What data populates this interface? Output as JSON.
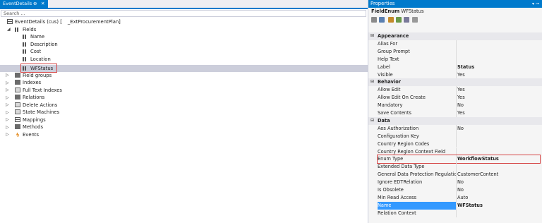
{
  "left_tab": {
    "title": "EventDetails",
    "pin": "⊕",
    "close": "✕"
  },
  "search": {
    "placeholder": "Search ..."
  },
  "tree": {
    "root": "EventDetails (cus) [",
    "root_model": "_ExtProcurementPlan]",
    "fields_label": "Fields",
    "fields": [
      "Name",
      "Description",
      "Cost",
      "Location",
      "WFStatus"
    ],
    "nodes": [
      "Field groups",
      "Indexes",
      "Full Text Indexes",
      "Relations",
      "Delete Actions",
      "State Machines",
      "Mappings",
      "Methods",
      "Events"
    ]
  },
  "properties": {
    "title": "Properties",
    "title_controls": "▾ ⊸",
    "object_type": "FieldEnum",
    "object_name": "WFStatus",
    "categories": [
      {
        "name": "Appearance",
        "rows": [
          {
            "k": "Alias For",
            "v": ""
          },
          {
            "k": "Group Prompt",
            "v": ""
          },
          {
            "k": "Help Text",
            "v": ""
          },
          {
            "k": "Label",
            "v": "Status"
          },
          {
            "k": "Visible",
            "v": "Yes"
          }
        ]
      },
      {
        "name": "Behavior",
        "rows": [
          {
            "k": "Allow Edit",
            "v": "Yes"
          },
          {
            "k": "Allow Edit On Create",
            "v": "Yes"
          },
          {
            "k": "Mandatory",
            "v": "No"
          },
          {
            "k": "Save Contents",
            "v": "Yes"
          }
        ]
      },
      {
        "name": "Data",
        "rows": [
          {
            "k": "Aos Authorization",
            "v": "No"
          },
          {
            "k": "Configuration Key",
            "v": ""
          },
          {
            "k": "Country Region Codes",
            "v": ""
          },
          {
            "k": "Country Region Context Field",
            "v": ""
          },
          {
            "k": "Enum Type",
            "v": "WorkflowStatus"
          },
          {
            "k": "Extended Data Type",
            "v": ""
          },
          {
            "k": "General Data Protection Regulation",
            "v": "CustomerContent"
          },
          {
            "k": "Ignore EDTRelation",
            "v": "No"
          },
          {
            "k": "Is Obsolete",
            "v": "No"
          },
          {
            "k": "Min Read Access",
            "v": "Auto"
          },
          {
            "k": "Name",
            "v": "WFStatus"
          },
          {
            "k": "Relation Context",
            "v": ""
          }
        ]
      }
    ]
  },
  "colors": {
    "accent": "#007acc",
    "highlight": "#d64545",
    "selection": "#3399ff"
  }
}
